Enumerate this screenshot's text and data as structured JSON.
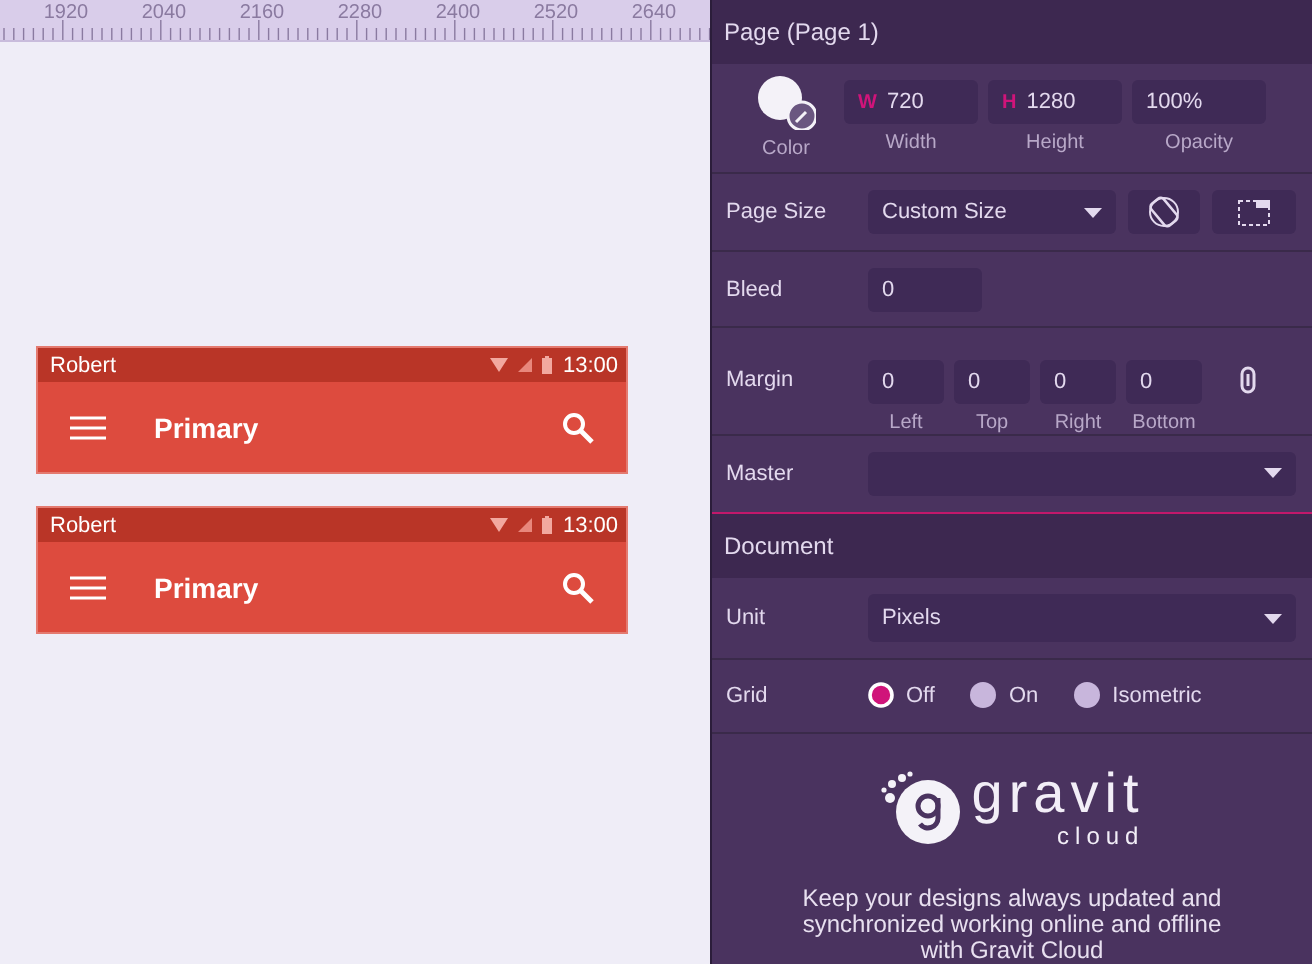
{
  "ruler": {
    "labels": [
      "1920",
      "2040",
      "2160",
      "2280",
      "2400",
      "2520",
      "2640"
    ]
  },
  "canvas": {
    "app_bars": [
      {
        "status_name": "Robert",
        "time": "13:00",
        "title": "Primary"
      },
      {
        "status_name": "Robert",
        "time": "13:00",
        "title": "Primary"
      }
    ]
  },
  "panel": {
    "page_header": "Page (Page 1)",
    "color_label": "Color",
    "size_fields": [
      {
        "prefix": "W",
        "value": "720",
        "label": "Width"
      },
      {
        "prefix": "H",
        "value": "1280",
        "label": "Height"
      },
      {
        "value": "100%",
        "label": "Opacity"
      }
    ],
    "page_size": {
      "label": "Page Size",
      "value": "Custom Size"
    },
    "bleed": {
      "label": "Bleed",
      "value": "0"
    },
    "margin": {
      "label": "Margin",
      "fields": [
        {
          "value": "0",
          "label": "Left"
        },
        {
          "value": "0",
          "label": "Top"
        },
        {
          "value": "0",
          "label": "Right"
        },
        {
          "value": "0",
          "label": "Bottom"
        }
      ]
    },
    "master": {
      "label": "Master"
    },
    "document_header": "Document",
    "unit": {
      "label": "Unit",
      "value": "Pixels"
    },
    "grid": {
      "label": "Grid",
      "options": [
        {
          "label": "Off",
          "selected": true
        },
        {
          "label": "On",
          "selected": false
        },
        {
          "label": "Isometric",
          "selected": false
        }
      ]
    },
    "promo": {
      "logo_word": "gravit",
      "logo_sub": "cloud",
      "text": "Keep your designs always updated and synchronized working online and offline with Gravit Cloud"
    }
  }
}
